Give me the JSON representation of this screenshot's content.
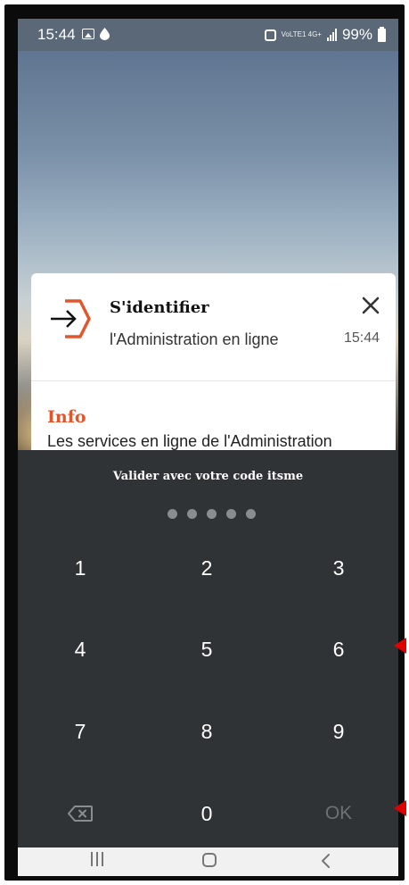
{
  "status_bar": {
    "time": "15:44",
    "network": "VoLTE1 4G+",
    "battery": "99%"
  },
  "notification": {
    "app_icon": "login-arrow-hexagon-icon",
    "title": "S'identifier",
    "subtitle": "l'Administration en ligne",
    "time": "15:44",
    "close_icon": "close-icon",
    "info_title": "Info",
    "info_text": "Les services en ligne de l'Administration"
  },
  "keypad": {
    "prompt": "Valider avec votre code itsme",
    "pin_dots": 5,
    "keys": [
      "1",
      "2",
      "3",
      "4",
      "5",
      "6",
      "7",
      "8",
      "9",
      "backspace",
      "0",
      "OK"
    ],
    "ok_label": "OK",
    "backspace_icon": "backspace-icon"
  },
  "nav_bar": {
    "recents": "recents-icon",
    "home": "home-icon",
    "back": "back-icon"
  },
  "colors": {
    "accent": "#e2562e",
    "keypad_bg": "#2f3335",
    "status_bar_bg": "#5b6877",
    "annotation_arrow": "#e00000"
  }
}
